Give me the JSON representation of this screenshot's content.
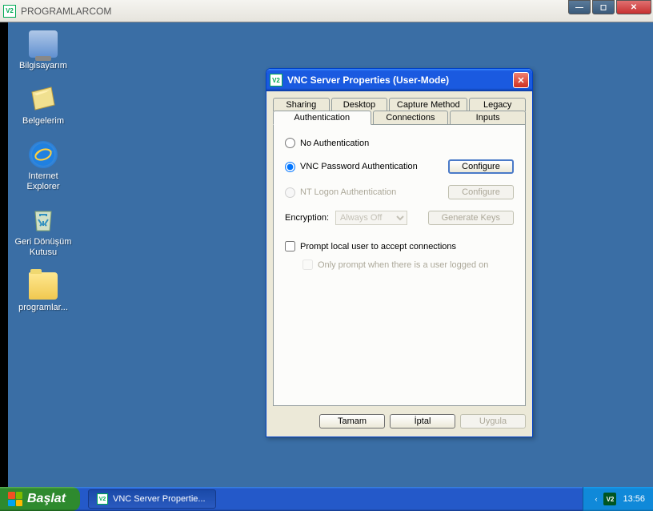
{
  "outer": {
    "title": "PROGRAMLARCOM"
  },
  "desktop": {
    "icons": [
      {
        "label": "Bilgisayarım"
      },
      {
        "label": "Belgelerim"
      },
      {
        "label": "Internet Explorer"
      },
      {
        "label": "Geri Dönüşüm Kutusu"
      },
      {
        "label": "programlar..."
      }
    ]
  },
  "taskbar": {
    "start": "Başlat",
    "task": "VNC Server Propertie...",
    "clock": "13:56"
  },
  "dialog": {
    "title": "VNC Server Properties (User-Mode)",
    "tabs_back": [
      "Sharing",
      "Desktop",
      "Capture Method",
      "Legacy"
    ],
    "tabs_front": [
      "Authentication",
      "Connections",
      "Inputs"
    ],
    "active_tab": "Authentication",
    "auth": {
      "no_auth": "No Authentication",
      "vnc_pw": "VNC Password Authentication",
      "nt_logon": "NT Logon Authentication",
      "configure": "Configure",
      "encryption_label": "Encryption:",
      "encryption_value": "Always Off",
      "gen_keys": "Generate Keys",
      "prompt_local": "Prompt local user to accept connections",
      "only_prompt": "Only prompt when there is a user logged on",
      "selected": "vnc_pw"
    },
    "buttons": {
      "ok": "Tamam",
      "cancel": "İptal",
      "apply": "Uygula"
    }
  }
}
